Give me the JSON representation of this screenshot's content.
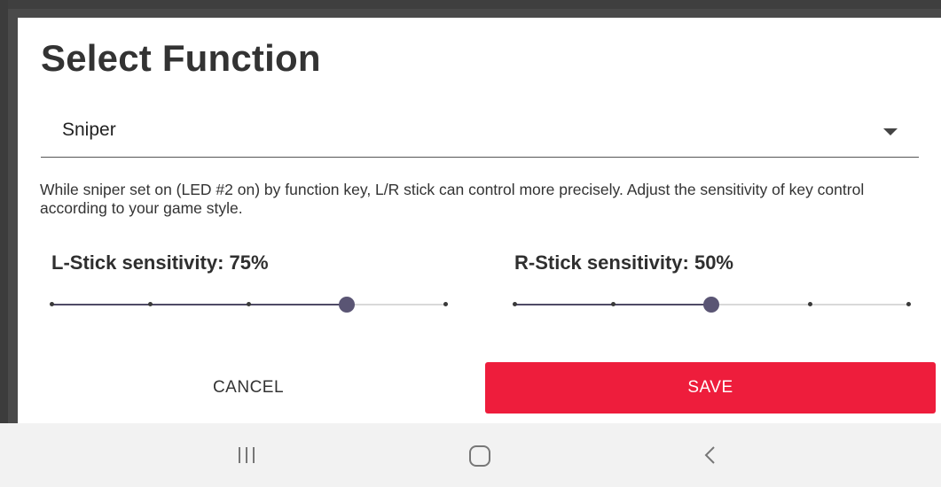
{
  "dialog": {
    "title": "Select Function",
    "dropdown": {
      "selected": "Sniper"
    },
    "description": "While sniper set on (LED #2 on) by function key, L/R stick can control more precisely. Adjust the sensitivity of key control according to your game style."
  },
  "sliders": {
    "left": {
      "label": "L-Stick sensitivity: 75%",
      "value_percent": 75,
      "ticks": [
        0,
        25,
        50,
        75,
        100
      ]
    },
    "right": {
      "label": "R-Stick sensitivity: 50%",
      "value_percent": 50,
      "ticks": [
        0,
        25,
        50,
        75,
        100
      ]
    }
  },
  "actions": {
    "cancel_label": "CANCEL",
    "save_label": "SAVE"
  },
  "navbar": {
    "icons": [
      "recents-icon",
      "home-icon",
      "back-icon"
    ]
  },
  "colors": {
    "accent": "#ee1d3c",
    "slider_fill": "#4f4a66",
    "slider_thumb": "#5a5574"
  }
}
